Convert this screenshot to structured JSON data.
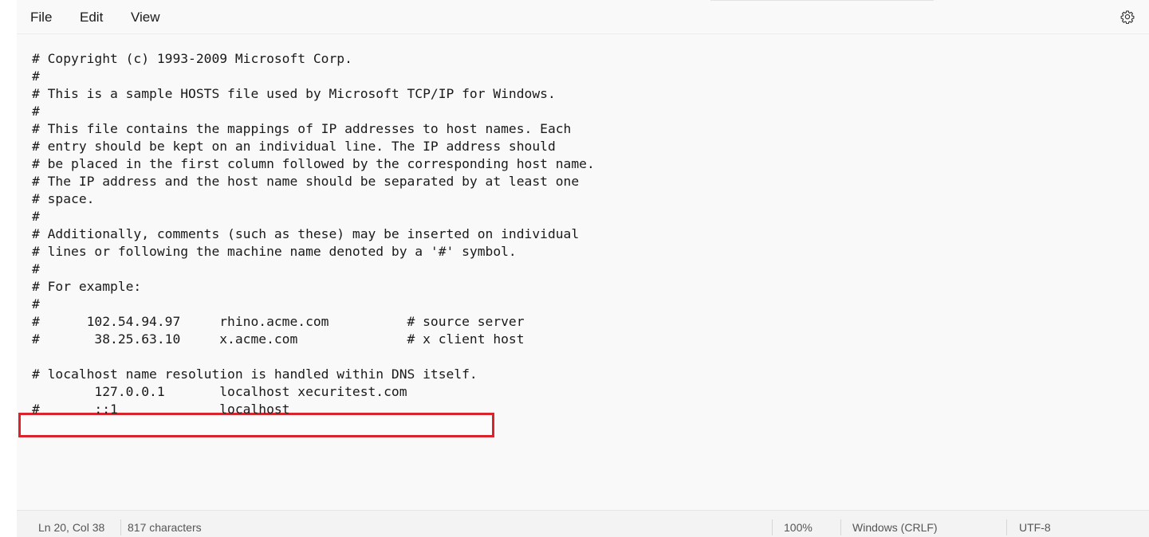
{
  "menubar": {
    "items": [
      "File",
      "Edit",
      "View"
    ],
    "settings_icon": "gear-icon"
  },
  "editor": {
    "lines": [
      "# Copyright (c) 1993-2009 Microsoft Corp.",
      "#",
      "# This is a sample HOSTS file used by Microsoft TCP/IP for Windows.",
      "#",
      "# This file contains the mappings of IP addresses to host names. Each",
      "# entry should be kept on an individual line. The IP address should",
      "# be placed in the first column followed by the corresponding host name.",
      "# The IP address and the host name should be separated by at least one",
      "# space.",
      "#",
      "# Additionally, comments (such as these) may be inserted on individual",
      "# lines or following the machine name denoted by a '#' symbol.",
      "#",
      "# For example:",
      "#",
      "#      102.54.94.97     rhino.acme.com          # source server",
      "#       38.25.63.10     x.acme.com              # x client host",
      "",
      "# localhost name resolution is handled within DNS itself.",
      "        127.0.0.1       localhost xecuritest.com",
      "#       ::1             localhost"
    ],
    "highlight_color": "#d9242b"
  },
  "statusbar": {
    "position": "Ln 20, Col 38",
    "characters": "817 characters",
    "zoom": "100%",
    "line_ending": "Windows (CRLF)",
    "encoding": "UTF-8"
  }
}
